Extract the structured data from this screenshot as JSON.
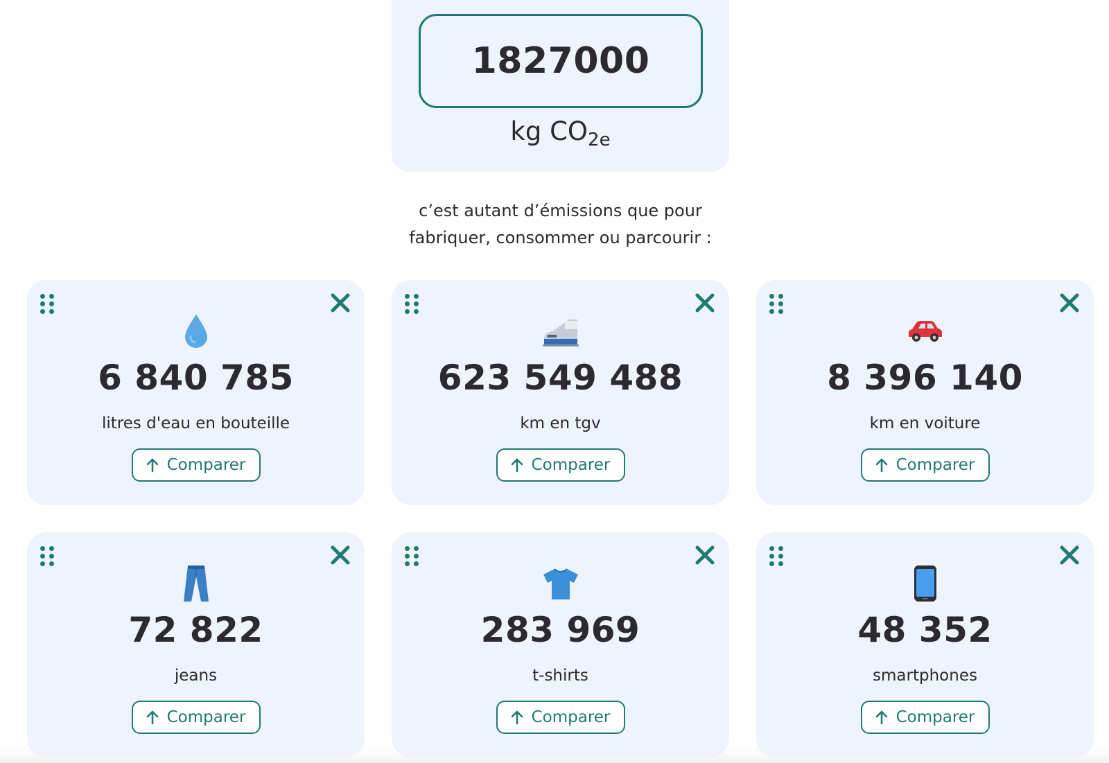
{
  "co2": {
    "value": "1827000",
    "unit_main": "kg CO",
    "unit_sub": "2e"
  },
  "intro": {
    "line1": "c’est autant d’émissions que pour",
    "line2": "fabriquer, consommer ou parcourir :"
  },
  "colors": {
    "accent": "#1f7a73",
    "card_bg": "#eef3fc",
    "text": "#2c2a30"
  },
  "cards": [
    {
      "icon": "water-drop-icon",
      "value": "6 840 785",
      "label": "litres d'eau en bouteille",
      "compare": "Comparer"
    },
    {
      "icon": "tgv-train-icon",
      "value": "623 549 488",
      "label": "km en tgv",
      "compare": "Comparer"
    },
    {
      "icon": "car-icon",
      "value": "8 396 140",
      "label": "km en voiture",
      "compare": "Comparer"
    },
    {
      "icon": "jeans-icon",
      "value": "72 822",
      "label": "jeans",
      "compare": "Comparer"
    },
    {
      "icon": "tshirt-icon",
      "value": "283 969",
      "label": "t-shirts",
      "compare": "Comparer"
    },
    {
      "icon": "smartphone-icon",
      "value": "48 352",
      "label": "smartphones",
      "compare": "Comparer"
    }
  ]
}
